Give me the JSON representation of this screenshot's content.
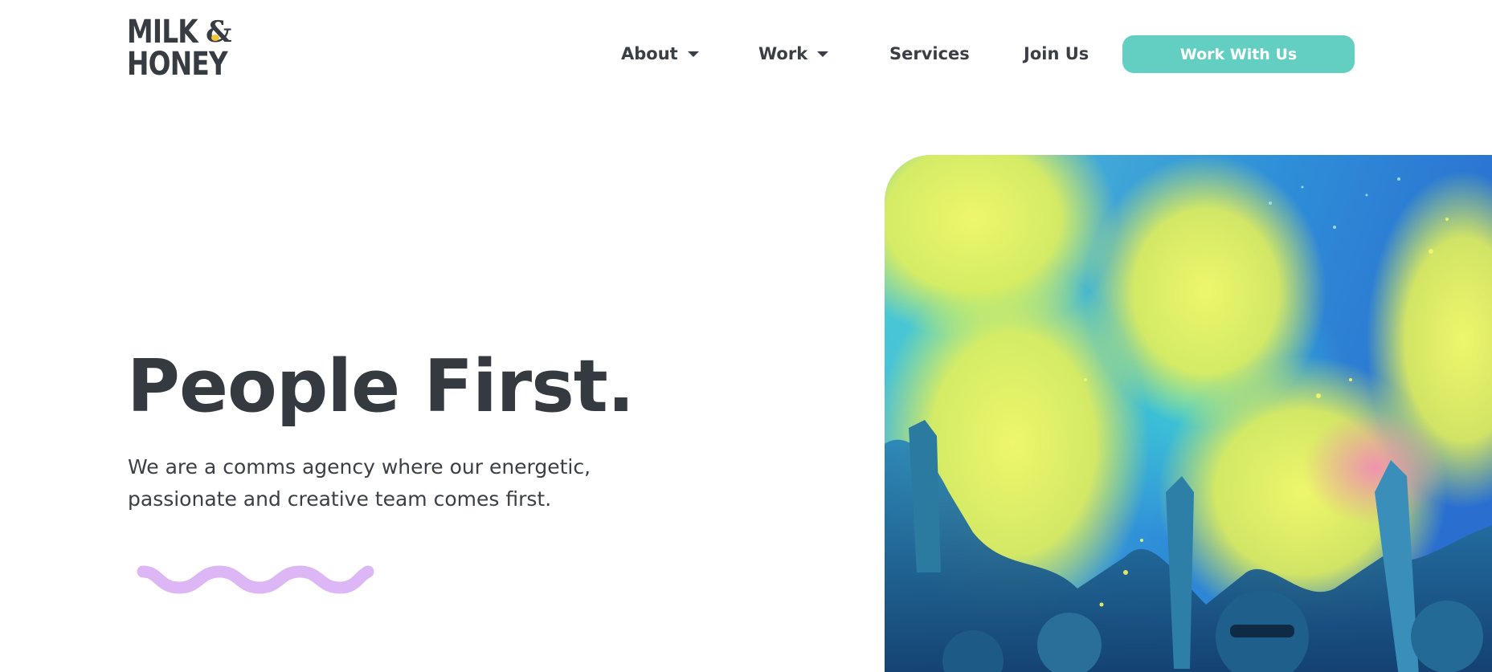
{
  "brand": {
    "logo_line1": "MILK",
    "logo_line2": "HONEY",
    "logo_ampersand": "&"
  },
  "nav": {
    "items": [
      {
        "label": "About",
        "has_dropdown": true
      },
      {
        "label": "Work",
        "has_dropdown": true
      },
      {
        "label": "Services",
        "has_dropdown": false
      },
      {
        "label": "Join Us",
        "has_dropdown": false
      }
    ],
    "cta_label": "Work With Us"
  },
  "hero": {
    "title": "People First.",
    "text": "We are a comms agency where our energetic, passionate and creative team comes first.",
    "image_icon": "color-powder-crowd-photo",
    "decoration_icon": "wavy-line-icon"
  },
  "colors": {
    "accent": "#63cfc2",
    "text": "#343a40",
    "squiggle": "#ddb6f5"
  }
}
